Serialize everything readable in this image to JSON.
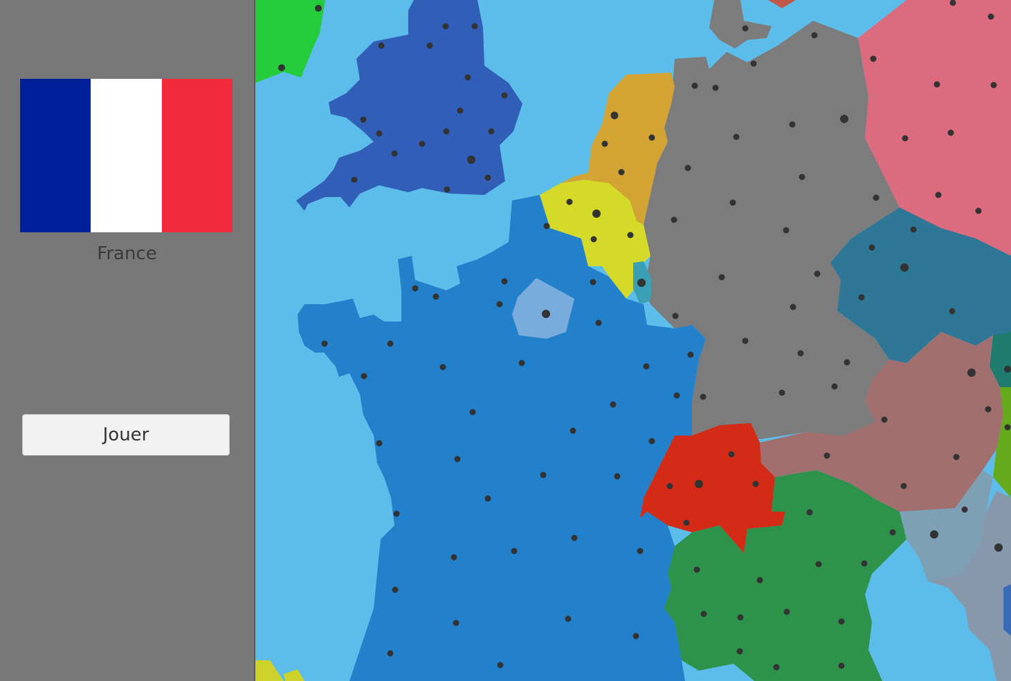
{
  "sidebar": {
    "flag": {
      "icon": "france-flag-icon",
      "colors": [
        "#00209a",
        "#ffffff",
        "#ef2b3c"
      ]
    },
    "country_name": "France",
    "play_button_label": "Jouer"
  },
  "map": {
    "sea_color": "#5dbdea",
    "selected_region": "france",
    "regions": [
      {
        "id": "france",
        "color": "#2380cb"
      },
      {
        "id": "paris",
        "color": "#79acdd"
      },
      {
        "id": "united-kingdom",
        "color": "#315fb7"
      },
      {
        "id": "ireland",
        "color": "#24cc3b"
      },
      {
        "id": "netherlands",
        "color": "#d3a334"
      },
      {
        "id": "belgium",
        "color": "#d5da29"
      },
      {
        "id": "luxembourg",
        "color": "#3aa0b5"
      },
      {
        "id": "germany",
        "color": "#7c7c7c"
      },
      {
        "id": "denmark",
        "color": "#7c7c7c"
      },
      {
        "id": "poland",
        "color": "#dc6b80"
      },
      {
        "id": "czechia",
        "color": "#2e7797"
      },
      {
        "id": "austria",
        "color": "#a26f6f"
      },
      {
        "id": "switzerland",
        "color": "#d42b17"
      },
      {
        "id": "italy",
        "color": "#2e934a"
      },
      {
        "id": "slovenia",
        "color": "#7ea0b5"
      },
      {
        "id": "croatia",
        "color": "#8898ac"
      },
      {
        "id": "hungary",
        "color": "#66a91d"
      },
      {
        "id": "slovakia",
        "color": "#1f7b6e"
      },
      {
        "id": "spain",
        "color": "#cdd22a"
      },
      {
        "id": "sweden",
        "color": "#c0584a"
      }
    ]
  }
}
